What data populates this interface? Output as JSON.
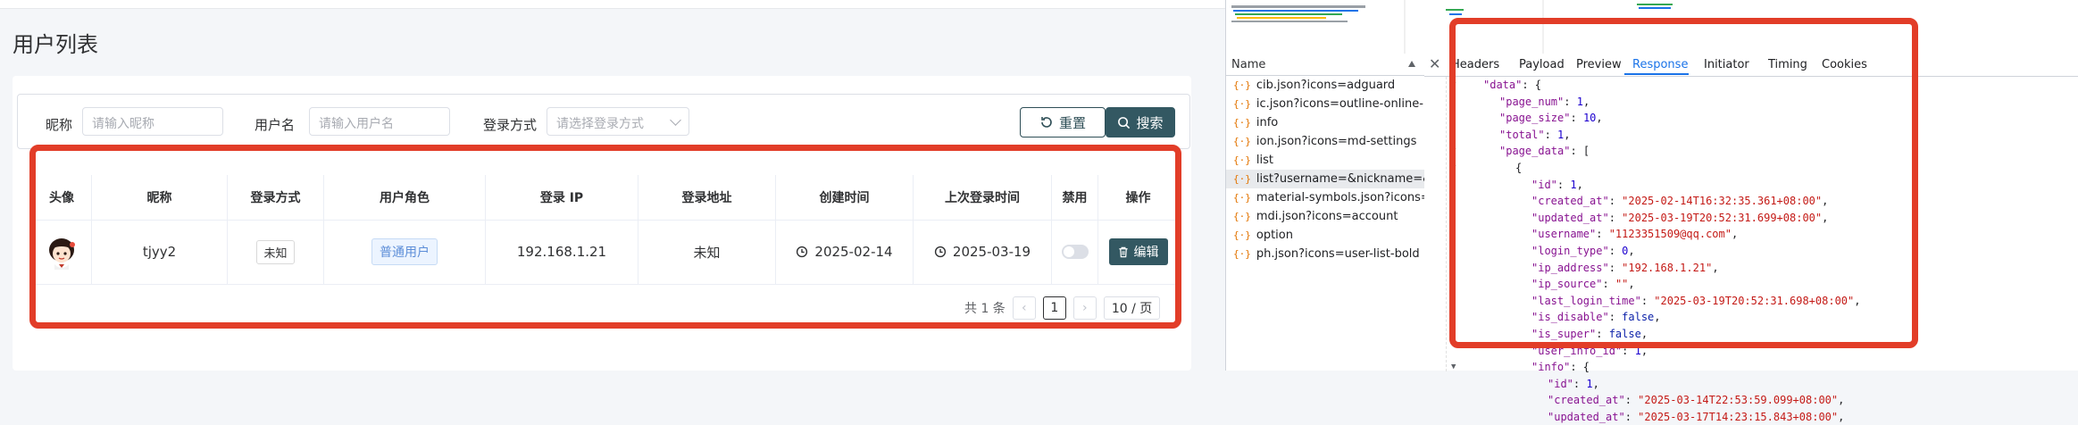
{
  "page": {
    "title": "用户列表"
  },
  "filters": {
    "nickname": {
      "label": "昵称",
      "placeholder": "请输入昵称"
    },
    "username": {
      "label": "用户名",
      "placeholder": "请输入用户名"
    },
    "login_type": {
      "label": "登录方式",
      "placeholder": "请选择登录方式"
    },
    "reset_label": "重置",
    "search_label": "搜索"
  },
  "table": {
    "headers": [
      "头像",
      "昵称",
      "登录方式",
      "用户角色",
      "登录 IP",
      "登录地址",
      "创建时间",
      "上次登录时间",
      "禁用",
      "操作"
    ],
    "rows": [
      {
        "nickname": "tjyy2",
        "login_type": "未知",
        "role": "普通用户",
        "ip": "192.168.1.21",
        "address": "未知",
        "created": "2025-02-14",
        "last_login": "2025-03-19",
        "disabled": false,
        "action": "编辑"
      }
    ]
  },
  "pagination": {
    "total_text": "共 1 条",
    "current": "1",
    "page_size": "10 / 页"
  },
  "colors": {
    "annotation_red": "#e23d28",
    "primary": "#335862",
    "devtools_blue": "#1a73e8"
  },
  "devtools": {
    "name_header": "Name",
    "requests": [
      "cib.json?icons=adguard",
      "ic.json?icons=outline-online-pr...",
      "info",
      "ion.json?icons=md-settings",
      "list",
      "list?username=&nickname=&pa...",
      "material-symbols.json?icons=r...",
      "mdi.json?icons=account",
      "option",
      "ph.json?icons=user-list-bold"
    ],
    "selected_request_index": 5,
    "tabs": [
      "Headers",
      "Payload",
      "Preview",
      "Response",
      "Initiator",
      "Timing",
      "Cookies"
    ],
    "active_tab": "Response",
    "response_lines": [
      {
        "indent": 2,
        "toggle": true,
        "key": "\"data\"",
        "sep": ": {",
        "val": "",
        "vt": "p"
      },
      {
        "indent": 3,
        "key": "\"page_num\"",
        "sep": ": ",
        "val": "1",
        "vt": "n",
        "end": ","
      },
      {
        "indent": 3,
        "key": "\"page_size\"",
        "sep": ": ",
        "val": "10",
        "vt": "n",
        "end": ","
      },
      {
        "indent": 3,
        "key": "\"total\"",
        "sep": ": ",
        "val": "1",
        "vt": "n",
        "end": ","
      },
      {
        "indent": 3,
        "toggle": true,
        "key": "\"page_data\"",
        "sep": ": [",
        "val": "",
        "vt": "p"
      },
      {
        "indent": 4,
        "toggle": true,
        "key": "",
        "sep": "{",
        "val": "",
        "vt": "p"
      },
      {
        "indent": 5,
        "key": "\"id\"",
        "sep": ": ",
        "val": "1",
        "vt": "n",
        "end": ","
      },
      {
        "indent": 5,
        "key": "\"created_at\"",
        "sep": ": ",
        "val": "\"2025-02-14T16:32:35.361+08:00\"",
        "vt": "s",
        "end": ","
      },
      {
        "indent": 5,
        "key": "\"updated_at\"",
        "sep": ": ",
        "val": "\"2025-03-19T20:52:31.699+08:00\"",
        "vt": "s",
        "end": ","
      },
      {
        "indent": 5,
        "key": "\"username\"",
        "sep": ": ",
        "val": "\"1123351509@qq.com\"",
        "vt": "s",
        "end": ","
      },
      {
        "indent": 5,
        "key": "\"login_type\"",
        "sep": ": ",
        "val": "0",
        "vt": "n",
        "end": ","
      },
      {
        "indent": 5,
        "key": "\"ip_address\"",
        "sep": ": ",
        "val": "\"192.168.1.21\"",
        "vt": "s",
        "end": ","
      },
      {
        "indent": 5,
        "key": "\"ip_source\"",
        "sep": ": ",
        "val": "\"\"",
        "vt": "s",
        "end": ","
      },
      {
        "indent": 5,
        "key": "\"last_login_time\"",
        "sep": ": ",
        "val": "\"2025-03-19T20:52:31.698+08:00\"",
        "vt": "s",
        "end": ","
      },
      {
        "indent": 5,
        "key": "\"is_disable\"",
        "sep": ": ",
        "val": "false",
        "vt": "b",
        "end": ","
      },
      {
        "indent": 5,
        "key": "\"is_super\"",
        "sep": ": ",
        "val": "false",
        "vt": "b",
        "end": ","
      },
      {
        "indent": 5,
        "key": "\"user_info_id\"",
        "sep": ": ",
        "val": "1",
        "vt": "n",
        "end": ","
      },
      {
        "indent": 5,
        "toggle": true,
        "key": "\"info\"",
        "sep": ": {",
        "val": "",
        "vt": "p"
      },
      {
        "indent": 6,
        "key": "\"id\"",
        "sep": ": ",
        "val": "1",
        "vt": "n",
        "end": ","
      },
      {
        "indent": 6,
        "key": "\"created_at\"",
        "sep": ": ",
        "val": "\"2025-03-14T22:53:59.099+08:00\"",
        "vt": "s",
        "end": ","
      },
      {
        "indent": 6,
        "key": "\"updated_at\"",
        "sep": ": ",
        "val": "\"2025-03-17T14:23:15.843+08:00\"",
        "vt": "s",
        "end": ","
      }
    ]
  }
}
